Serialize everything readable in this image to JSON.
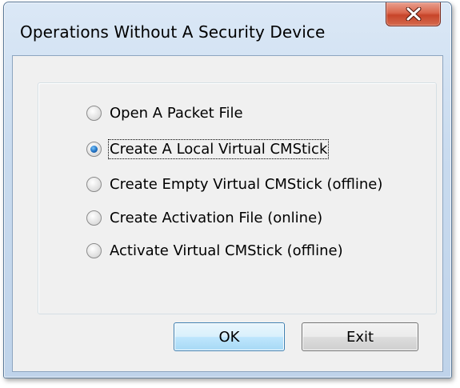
{
  "window": {
    "title": "Operations Without A Security Device"
  },
  "options": [
    {
      "label": "Open A Packet File",
      "checked": false
    },
    {
      "label": "Create A Local Virtual CMStick",
      "checked": true
    },
    {
      "label": "Create Empty Virtual CMStick (offline)",
      "checked": false
    },
    {
      "label": "Create Activation File  (online)",
      "checked": false
    },
    {
      "label": "Activate Virtual CMStick (offline)",
      "checked": false
    }
  ],
  "buttons": {
    "ok_label": "OK",
    "exit_label": "Exit"
  },
  "icons": {
    "close": "close-icon",
    "radio": "radio-button"
  },
  "colors": {
    "close_button": "#c7452a",
    "default_button_border": "#3c7fb1",
    "radio_selected": "#2a7fd0"
  }
}
